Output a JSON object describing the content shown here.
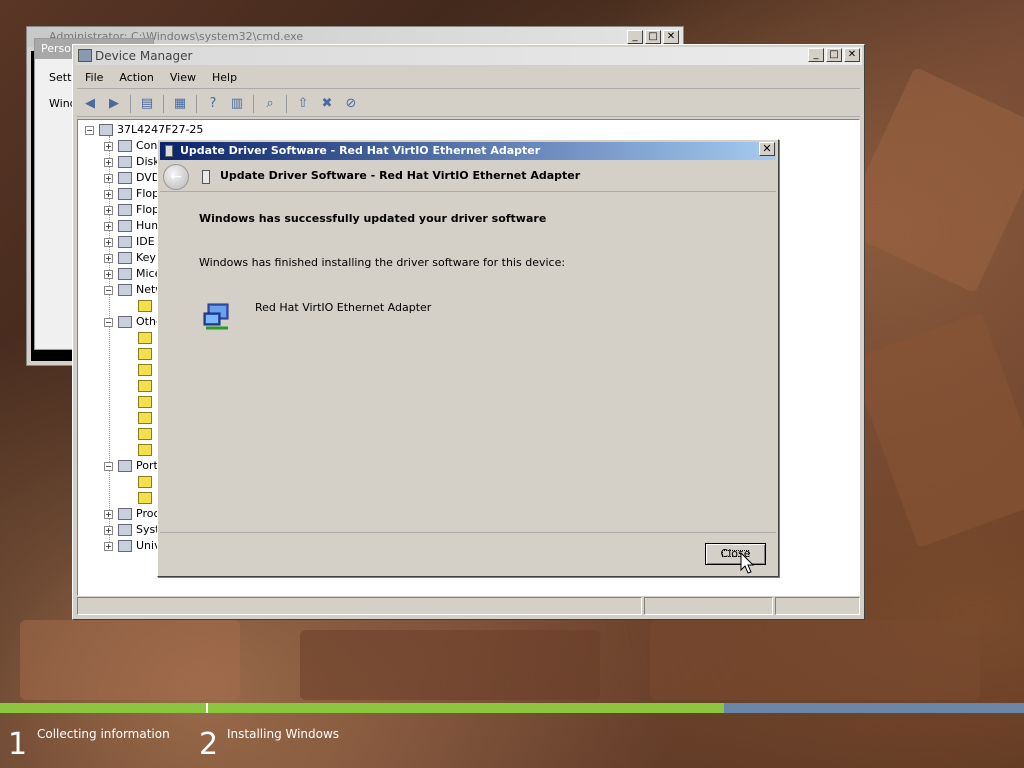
{
  "cmd_window": {
    "title": "Administrator: C:\\Windows\\system32\\cmd.exe",
    "minimize": "_",
    "maximize": "□",
    "close": "✕"
  },
  "personalization": {
    "title": "Perso",
    "items": [
      "Settin",
      "Windo"
    ]
  },
  "device_manager": {
    "title": "Device Manager",
    "menu": [
      "File",
      "Action",
      "View",
      "Help"
    ],
    "root": "37L4247F27-25",
    "categories": [
      {
        "label": "Con",
        "expand": "+"
      },
      {
        "label": "Disk",
        "expand": "+"
      },
      {
        "label": "DVD",
        "expand": "+"
      },
      {
        "label": "Flop",
        "expand": "+"
      },
      {
        "label": "Flop",
        "expand": "+"
      },
      {
        "label": "Hum",
        "expand": "+"
      },
      {
        "label": "IDE",
        "expand": "+"
      },
      {
        "label": "Key",
        "expand": "+"
      },
      {
        "label": "Mice",
        "expand": "+"
      },
      {
        "label": "Netw",
        "expand": "−"
      },
      {
        "label": "Othe",
        "expand": "−"
      },
      {
        "label": "Port",
        "expand": "−"
      },
      {
        "label": "Proc",
        "expand": "+"
      },
      {
        "label": "Syst",
        "expand": "+"
      },
      {
        "label": "Univ",
        "expand": "+"
      }
    ],
    "minimize": "_",
    "maximize": "□",
    "close": "✕"
  },
  "dialog": {
    "title": "Update Driver Software - Red Hat VirtIO Ethernet Adapter",
    "header_title": "Update Driver Software - Red Hat VirtIO Ethernet Adapter",
    "success_heading": "Windows has successfully updated your driver software",
    "finished_text": "Windows has finished installing the driver software for this device:",
    "device_name": "Red Hat VirtIO Ethernet Adapter",
    "close_button": "Close",
    "close_x": "✕"
  },
  "setup_progress": {
    "fraction_complete": 0.707,
    "steps": [
      {
        "number": "1",
        "label": "Collecting information"
      },
      {
        "number": "2",
        "label": "Installing Windows"
      }
    ],
    "colors": {
      "done": "#8cc63e",
      "remaining": "#6a86a8"
    }
  }
}
